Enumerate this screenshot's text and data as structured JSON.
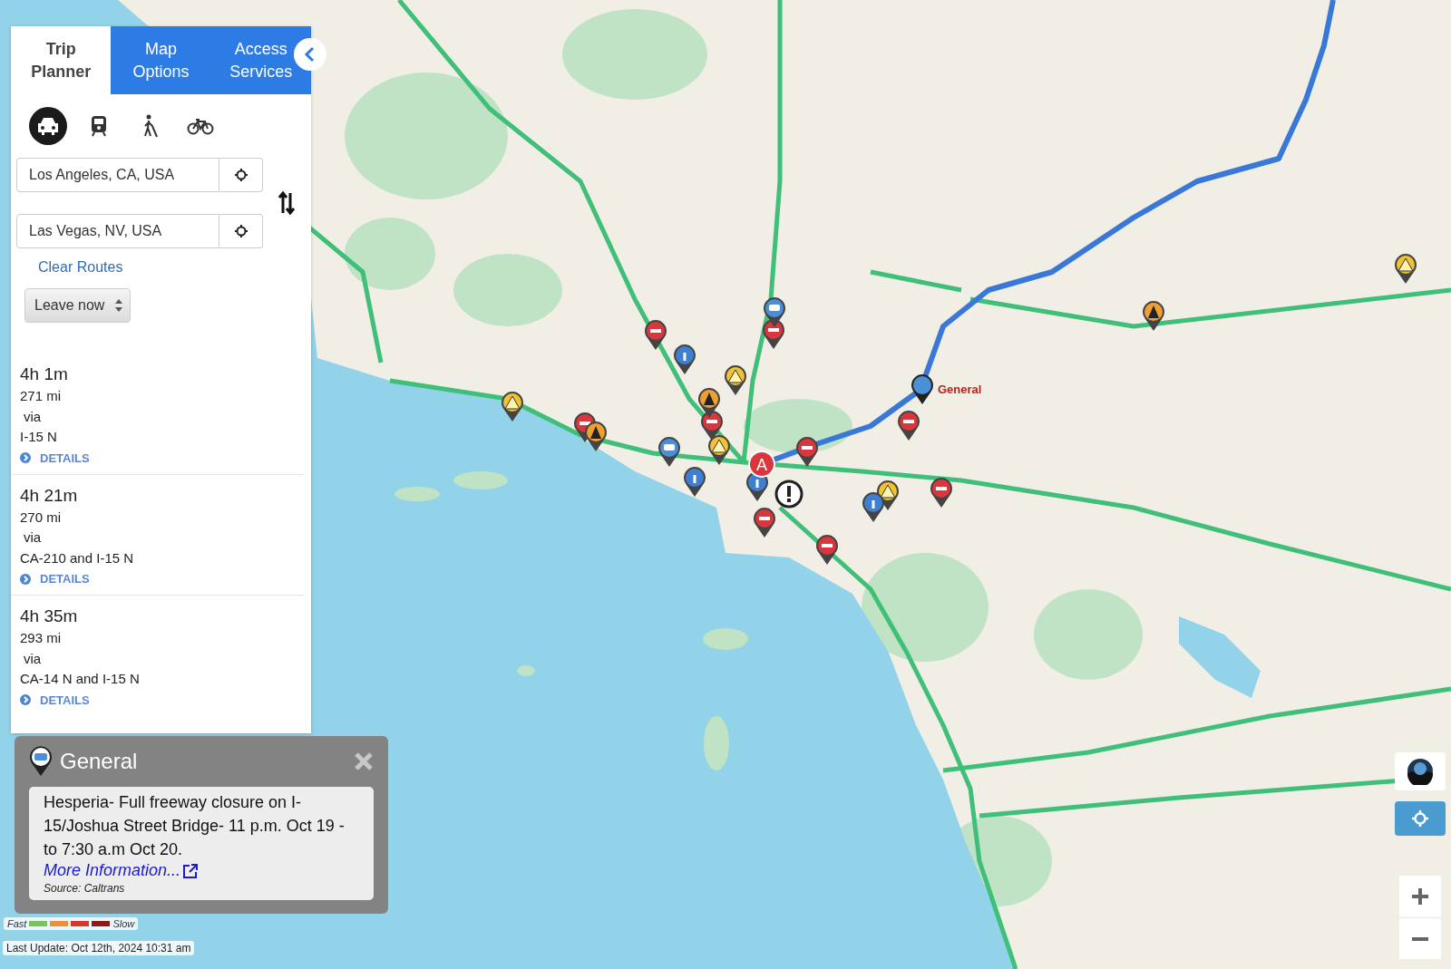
{
  "tabs": [
    {
      "label": "Trip Planner",
      "selected": true
    },
    {
      "label": "Map Options",
      "selected": false
    },
    {
      "label": "Access Services",
      "selected": false
    }
  ],
  "modes": [
    {
      "kind": "car",
      "selected": true
    },
    {
      "kind": "transit",
      "selected": false
    },
    {
      "kind": "walk",
      "selected": false
    },
    {
      "kind": "bike",
      "selected": false
    }
  ],
  "origin": {
    "value": "Los Angeles, CA, USA"
  },
  "destination": {
    "value": "Las Vegas, NV, USA"
  },
  "clear_routes": "Clear Routes",
  "departure": {
    "value": "Leave now"
  },
  "routes": [
    {
      "duration": "4h 1m",
      "distance": "271 mi",
      "via": "via",
      "road": "I-15 N",
      "details": "DETAILS"
    },
    {
      "duration": "4h 21m",
      "distance": "270 mi",
      "via": "via",
      "road": "CA-210 and I-15 N",
      "details": "DETAILS"
    },
    {
      "duration": "4h 35m",
      "distance": "293 mi",
      "via": "via",
      "road": "CA-14 N and I-15 N",
      "details": "DETAILS"
    }
  ],
  "map": {
    "start_marker": "A",
    "incident_label": "General"
  },
  "popup": {
    "title": "General",
    "body": "Hesperia- Full freeway closure on I-15/Joshua Street Bridge- 11 p.m. Oct 19 - to 7:30 a.m Oct 20.",
    "link": "More Information...",
    "source": "Source: Caltrans"
  },
  "legend": {
    "fast": "Fast",
    "slow": "Slow",
    "swatches": [
      {
        "color": "#7cc45a"
      },
      {
        "color": "#e8913a"
      },
      {
        "color": "#d33a2c"
      },
      {
        "color": "#8b1a1a"
      }
    ]
  },
  "last_update": "Last Update: Oct 12th, 2024 10:31 am"
}
